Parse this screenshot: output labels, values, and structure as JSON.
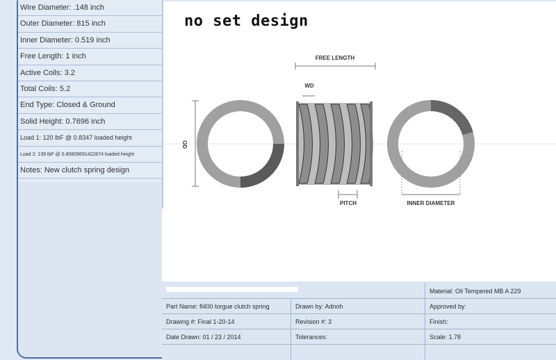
{
  "specs": [
    "Wire Diameter: .148 inch",
    "Outer Diameter: 815 inch",
    "Inner Diameter: 0.519 inch",
    "Free Length: 1 inch",
    "Active Coils: 3.2",
    "Total Coils: 5.2",
    "End Type: Closed & Ground",
    "Solid Height: 0.7696 inch",
    "Load 1: 120 lbF @ 0.8347 loaded height",
    "Load 2: 139 lbF @ 0.80809691422874 loaded height",
    "Notes: New clutch spring design"
  ],
  "drawing": {
    "title": "no set design",
    "labels": {
      "free_length": "FREE LENGTH",
      "wd": "WD",
      "od": "OD",
      "pitch": "PITCH",
      "inner_diameter": "INNER DIAMETER"
    }
  },
  "title_block": {
    "material": "Material: Oil Tempered MB A 229",
    "part_name": "Part Name: fl400 torgue clutch spring",
    "drawn_by": "Drawn by: Adnoh",
    "approved_by": "Approved by:",
    "drawing_no": "Drawing #: Final 1-20-14",
    "revision": "Revision #: 3",
    "finish": "Finish:",
    "date_drawn": "Date Drawn: 01 / 23 / 2014",
    "tolerances": "Tolerances:",
    "scale": "Scale: 1.78"
  },
  "colors": {
    "coil": "#9a9a9a",
    "coil_dark": "#555555",
    "frame": "#4a6ea8"
  }
}
